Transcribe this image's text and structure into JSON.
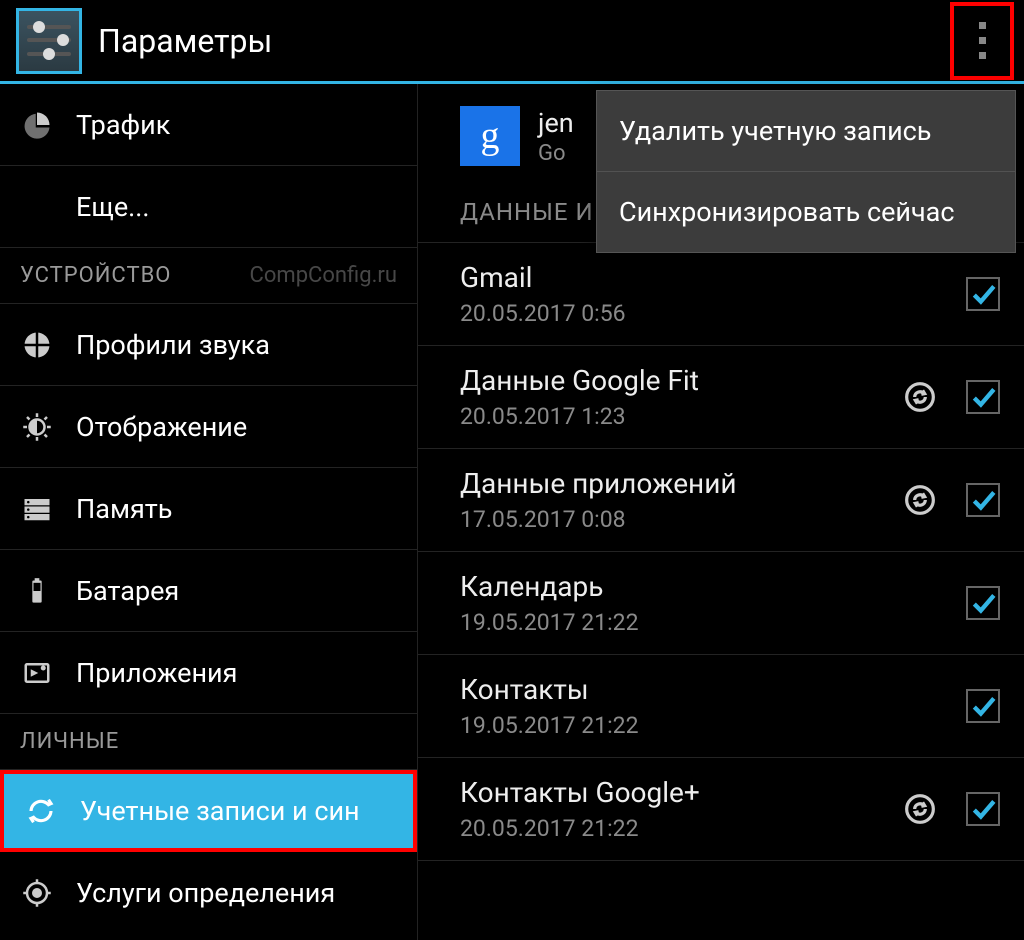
{
  "header": {
    "title": "Параметры"
  },
  "sidebar": {
    "section_device": "УСТРОЙСТВО",
    "section_personal": "ЛИЧНЫЕ",
    "watermark": "CompConfig.ru",
    "items": {
      "traffic": "Трафик",
      "more": "Еще...",
      "sound": "Профили звука",
      "display": "Отображение",
      "storage": "Память",
      "battery": "Батарея",
      "apps": "Приложения",
      "accounts": "Учетные записи и син",
      "location": "Услуги определения"
    }
  },
  "main": {
    "account_name": "jen",
    "account_sub": "Go",
    "data_section": "ДАННЫЕ И",
    "sync_items": [
      {
        "title": "Gmail",
        "time": "20.05.2017 0:56",
        "spinner": false,
        "checked": true
      },
      {
        "title": "Данные Google Fit",
        "time": "20.05.2017 1:23",
        "spinner": true,
        "checked": true
      },
      {
        "title": "Данные приложений",
        "time": "17.05.2017 0:08",
        "spinner": true,
        "checked": true
      },
      {
        "title": "Календарь",
        "time": "19.05.2017 21:22",
        "spinner": false,
        "checked": true
      },
      {
        "title": "Контакты",
        "time": "19.05.2017 21:22",
        "spinner": false,
        "checked": true
      },
      {
        "title": "Контакты Google+",
        "time": "20.05.2017 21:22",
        "spinner": true,
        "checked": true
      }
    ]
  },
  "popup": {
    "remove": "Удалить учетную запись",
    "sync_now": "Синхронизировать сейчас"
  }
}
